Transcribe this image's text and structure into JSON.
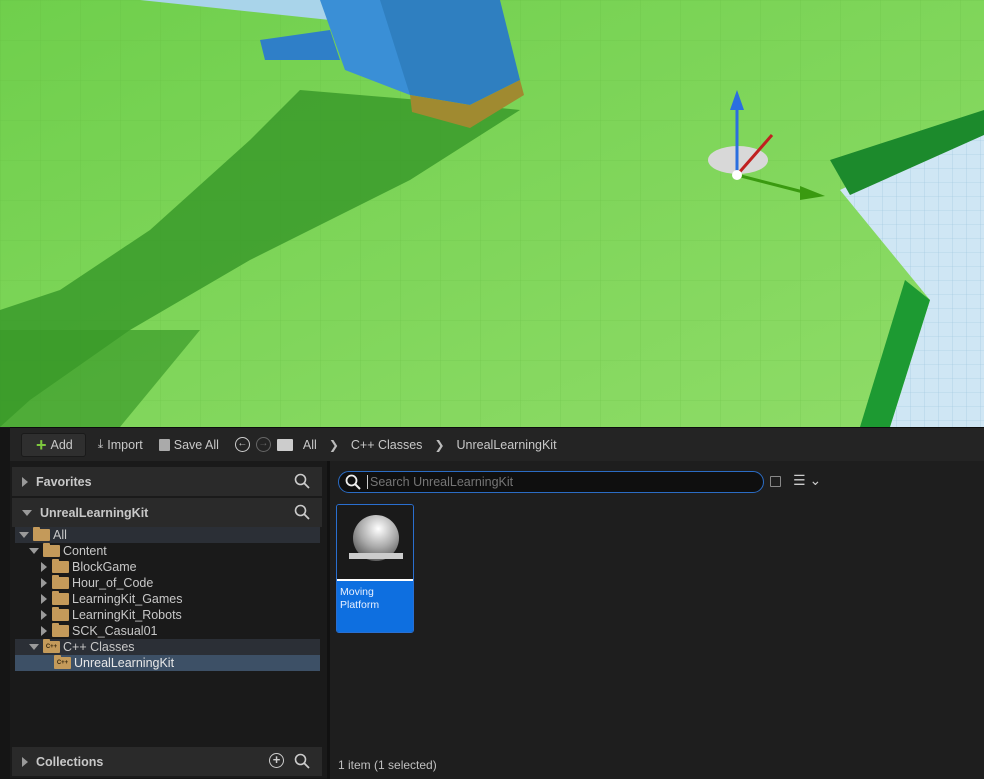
{
  "toolbar": {
    "add": "Add",
    "import": "Import",
    "save_all": "Save All"
  },
  "breadcrumb": [
    "All",
    "C++ Classes",
    "UnrealLearningKit"
  ],
  "left_panel": {
    "favorites": "Favorites",
    "project": "UnrealLearningKit",
    "collections": "Collections",
    "tree": {
      "all": "All",
      "content": "Content",
      "folders": [
        "BlockGame",
        "Hour_of_Code",
        "LearningKit_Games",
        "LearningKit_Robots",
        "SCK_Casual01"
      ],
      "cpp": "C++ Classes",
      "cpp_child": "UnrealLearningKit",
      "cpp_badge": "C++"
    }
  },
  "search": {
    "placeholder": "Search UnrealLearningKit",
    "value": ""
  },
  "assets": [
    {
      "name": "Moving Platform",
      "selected": true
    }
  ],
  "status": "1 item (1 selected)",
  "colors": {
    "accent": "#0e6fe0",
    "folder": "#c49a5a",
    "ground": "#7fd35a"
  }
}
